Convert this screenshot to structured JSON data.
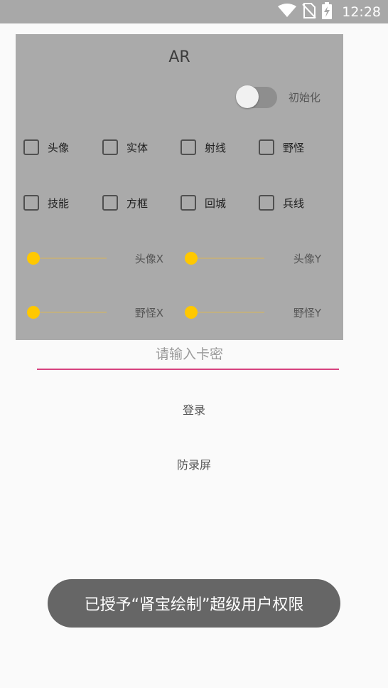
{
  "status_bar": {
    "time": "12:28",
    "icons": [
      "wifi-icon",
      "no-sim-icon",
      "battery-charging-icon"
    ]
  },
  "panel": {
    "title": "AR",
    "switch": {
      "label": "初始化",
      "on": false
    },
    "checkboxes_row1": [
      "头像",
      "实体",
      "射线",
      "野怪"
    ],
    "checkboxes_row2": [
      "技能",
      "方框",
      "回城",
      "兵线"
    ],
    "sliders": [
      {
        "label": "头像X",
        "value": 0
      },
      {
        "label": "头像Y",
        "value": 0
      },
      {
        "label": "野怪X",
        "value": 0
      },
      {
        "label": "野怪Y",
        "value": 0
      }
    ]
  },
  "login": {
    "card_placeholder": "请输入卡密",
    "login_label": "登录",
    "anti_record_label": "防录屏"
  },
  "toast": {
    "text": "已授予“肾宝绘制”超级用户权限"
  },
  "colors": {
    "accent_underline": "#d6437f",
    "slider_knob": "#ffc800",
    "panel_bg": "#aaaaaa"
  }
}
